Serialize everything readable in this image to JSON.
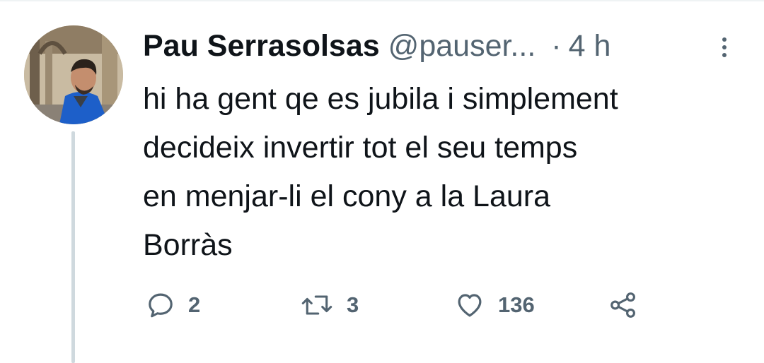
{
  "tweet": {
    "author": {
      "display_name": "Pau Serrasolsas",
      "handle": "@pauser...",
      "avatar_icon": "profile-photo"
    },
    "separator": "·",
    "time": "4 h",
    "text_lines": [
      "hi ha gent qe es jubila i simplement",
      "decideix invertir tot el seu temps",
      "en menjar-li el cony a la Laura",
      "Borràs"
    ],
    "actions": {
      "reply": {
        "icon": "reply-icon",
        "count": "2"
      },
      "retweet": {
        "icon": "retweet-icon",
        "count": "3"
      },
      "like": {
        "icon": "heart-icon",
        "count": "136"
      },
      "share": {
        "icon": "share-icon"
      }
    },
    "more_icon": "more-vertical-icon"
  },
  "colors": {
    "text_primary": "#0f1419",
    "text_secondary": "#536471",
    "thread_line": "#cfd9de",
    "background": "#ffffff"
  }
}
